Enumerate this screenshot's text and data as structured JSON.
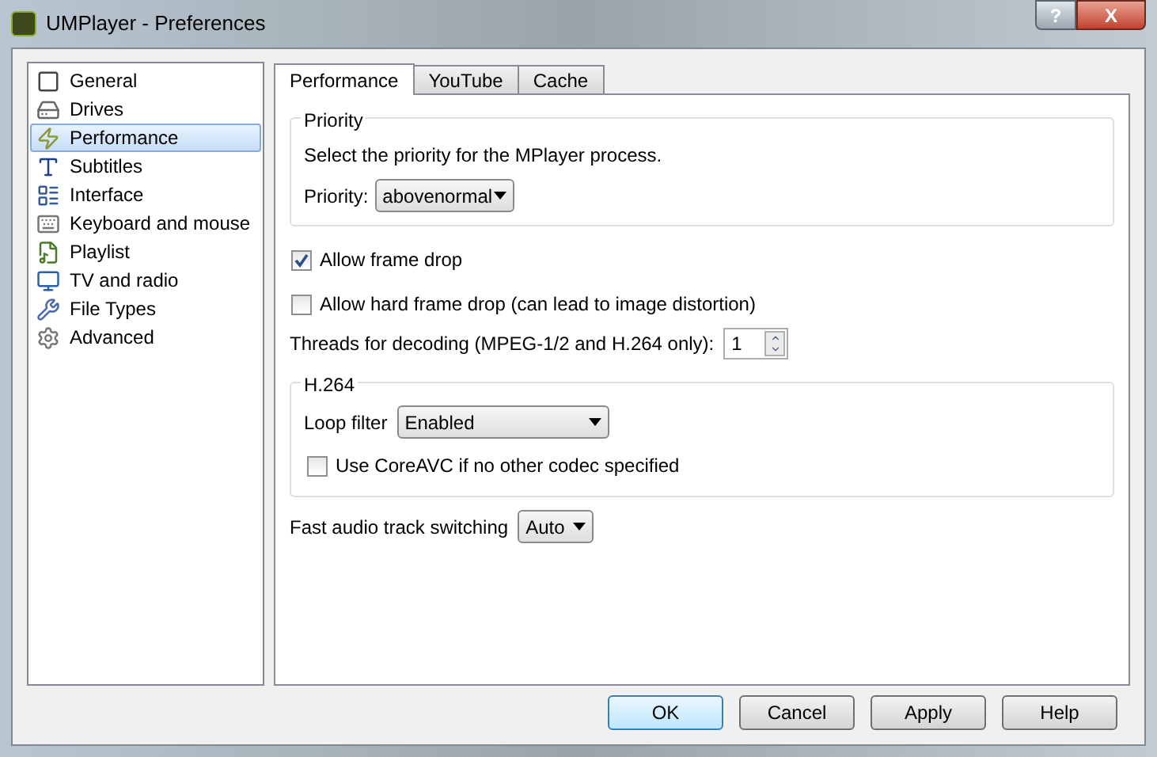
{
  "window": {
    "title": "UMPlayer - Preferences",
    "help_button": "?",
    "close_button": "X"
  },
  "sidebar": {
    "items": [
      {
        "label": "General",
        "selected": false
      },
      {
        "label": "Drives",
        "selected": false
      },
      {
        "label": "Performance",
        "selected": true
      },
      {
        "label": "Subtitles",
        "selected": false
      },
      {
        "label": "Interface",
        "selected": false
      },
      {
        "label": "Keyboard and mouse",
        "selected": false
      },
      {
        "label": "Playlist",
        "selected": false
      },
      {
        "label": "TV and radio",
        "selected": false
      },
      {
        "label": "File Types",
        "selected": false
      },
      {
        "label": "Advanced",
        "selected": false
      }
    ]
  },
  "tabs": [
    {
      "label": "Performance",
      "selected": true
    },
    {
      "label": "YouTube",
      "selected": false
    },
    {
      "label": "Cache",
      "selected": false
    }
  ],
  "priority_group": {
    "title": "Priority",
    "description": "Select the priority for the MPlayer process.",
    "label": "Priority:",
    "value": "abovenormal"
  },
  "checkboxes": [
    {
      "label": "Allow frame drop",
      "checked": true
    },
    {
      "label": "Allow hard frame drop (can lead to image distortion)",
      "checked": false
    }
  ],
  "threads": {
    "label": "Threads for decoding (MPEG-1/2 and H.264 only):",
    "value": "1"
  },
  "h264_group": {
    "title": "H.264",
    "loop_filter_label": "Loop filter",
    "loop_filter_value": "Enabled",
    "coreavc": {
      "label": "Use CoreAVC if no other codec specified",
      "checked": false
    }
  },
  "audio_switching": {
    "label": "Fast audio track switching",
    "value": "Auto"
  },
  "buttons": [
    {
      "label": "OK",
      "selected": true
    },
    {
      "label": "Cancel",
      "selected": false
    },
    {
      "label": "Apply",
      "selected": false
    },
    {
      "label": "Help",
      "selected": false
    }
  ]
}
